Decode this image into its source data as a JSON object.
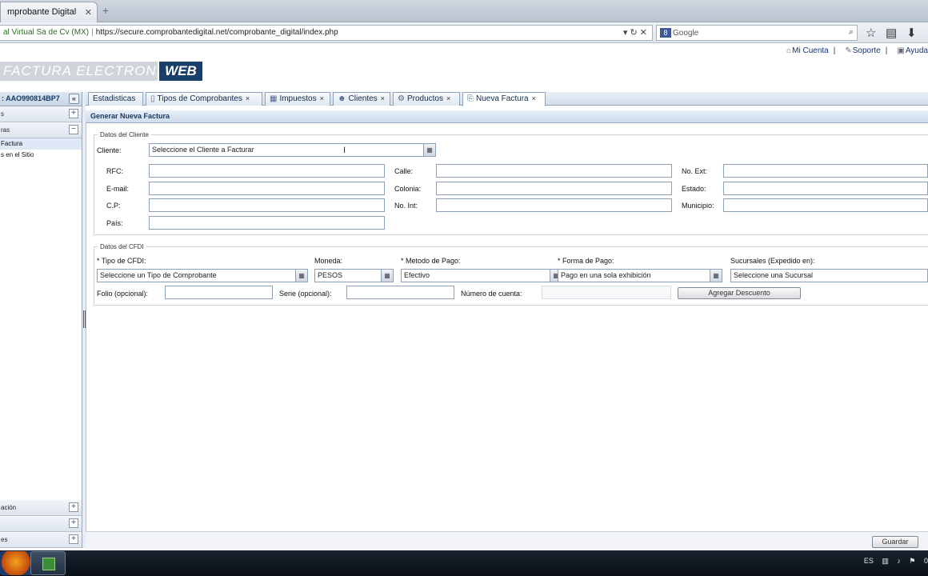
{
  "browser": {
    "tab_title": "mprobante Digital",
    "identity": "al Virtual Sa de Cv (MX)",
    "url": "https://secure.comprobantedigital.net/comprobante_digital/index.php",
    "search_engine": "Google",
    "search_placeholder": "Google"
  },
  "header": {
    "logo_text": "FACTURA ELECTRONICA",
    "logo_web": "WEB",
    "links": [
      "Mi Cuenta",
      "Soporte",
      "Ayuda"
    ]
  },
  "left_panel": {
    "title": ": AAO990814BP7",
    "collapse": "«",
    "sections_top": [
      {
        "label": "s",
        "toggle": "+"
      },
      {
        "label": "ras",
        "toggle": "−"
      }
    ],
    "items": [
      "Factura",
      "s en el Sitio"
    ],
    "sections_bottom": [
      {
        "label": "ación",
        "toggle": "+"
      },
      {
        "label": "",
        "toggle": "+"
      },
      {
        "label": "es",
        "toggle": "+"
      }
    ]
  },
  "tabs": [
    {
      "label": "Estadisticas",
      "close": ""
    },
    {
      "label": "Tipos de Comprobantes",
      "close": "×"
    },
    {
      "label": "Impuestos",
      "close": "×"
    },
    {
      "label": "Clientes",
      "close": "×"
    },
    {
      "label": "Productos",
      "close": "×"
    },
    {
      "label": "Nueva Factura",
      "close": "×"
    }
  ],
  "section_title": "Generar Nueva Factura",
  "cliente": {
    "legend": "Datos del Cliente",
    "cliente_label": "Cliente:",
    "cliente_value": "Seleccione el Cliente a Facturar",
    "rfc": "RFC:",
    "email": "E-mail:",
    "cp": "C.P:",
    "pais": "País:",
    "calle": "Calle:",
    "colonia": "Colonia:",
    "no_int": "No. Int:",
    "no_ext": "No. Ext:",
    "estado": "Estado:",
    "municipio": "Municipio:"
  },
  "cfdi": {
    "legend": "Datos del CFDI",
    "tipo_label": "* Tipo de CFDI:",
    "tipo_value": "Seleccione un Tipo de Comprobante",
    "moneda_label": "Moneda:",
    "moneda_value": "PESOS",
    "metodo_label": "* Metodo de Pago:",
    "metodo_value": "Efectivo",
    "forma_label": "* Forma de Pago:",
    "forma_value": "Pago en una sola exhibición",
    "sucursales_label": "Sucursales (Expedido en):",
    "sucursales_value": "Seleccione una Sucursal",
    "folio_label": "Folio (opcional):",
    "serie_label": "Serie (opcional):",
    "cuenta_label": "Número de cuenta:",
    "agregar_button": "Agregar Descuento"
  },
  "footer": {
    "guardar": "Guardar"
  },
  "taskbar": {
    "lang": "ES",
    "clock": "0"
  }
}
